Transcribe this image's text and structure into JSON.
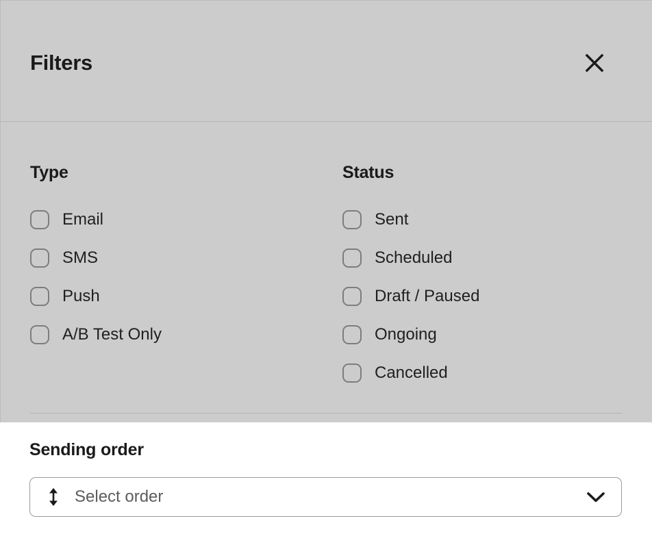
{
  "header": {
    "title": "Filters",
    "close_icon": "close-icon"
  },
  "filters": {
    "groups": [
      {
        "heading": "Type",
        "options": [
          {
            "label": "Email",
            "checked": false
          },
          {
            "label": "SMS",
            "checked": false
          },
          {
            "label": "Push",
            "checked": false
          },
          {
            "label": "A/B Test Only",
            "checked": false
          }
        ]
      },
      {
        "heading": "Status",
        "options": [
          {
            "label": "Sent",
            "checked": false
          },
          {
            "label": "Scheduled",
            "checked": false
          },
          {
            "label": "Draft / Paused",
            "checked": false
          },
          {
            "label": "Ongoing",
            "checked": false
          },
          {
            "label": "Cancelled",
            "checked": false
          }
        ]
      }
    ]
  },
  "sending_order": {
    "label": "Sending order",
    "placeholder": "Select order",
    "value": "",
    "leading_icon": "sort-vertical-icon",
    "trailing_icon": "chevron-down-icon"
  },
  "colors": {
    "panel_background": "#cccccc",
    "footer_background": "#ffffff",
    "divider": "#b4b4b4",
    "text_primary": "#1a1a1a",
    "text_placeholder": "#5c5c5c",
    "checkbox_border": "#7d7d7d",
    "select_border": "#9a9a9a"
  }
}
